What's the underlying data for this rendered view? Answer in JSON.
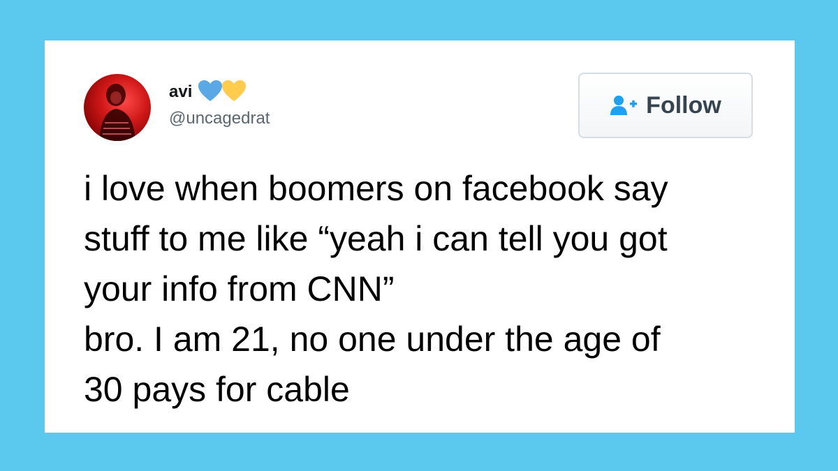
{
  "colors": {
    "background": "#5bc8ee",
    "card": "#ffffff",
    "heart_blue": "#5aa9e6",
    "heart_yellow": "#ffcc4d",
    "follow_icon": "#1da1f2"
  },
  "tweet": {
    "author": {
      "display_name": "avi",
      "handle": "@uncagedrat",
      "avatar_icon": "profile-photo",
      "name_emojis": [
        "blue-heart",
        "yellow-heart"
      ]
    },
    "follow_button": {
      "label": "Follow",
      "icon": "add-user-icon"
    },
    "text_lines": [
      "i love when boomers on facebook say",
      "stuff to me like “yeah i can tell you got",
      "your info from CNN”",
      "bro. I am 21, no one under the age of",
      "30 pays for cable"
    ]
  }
}
